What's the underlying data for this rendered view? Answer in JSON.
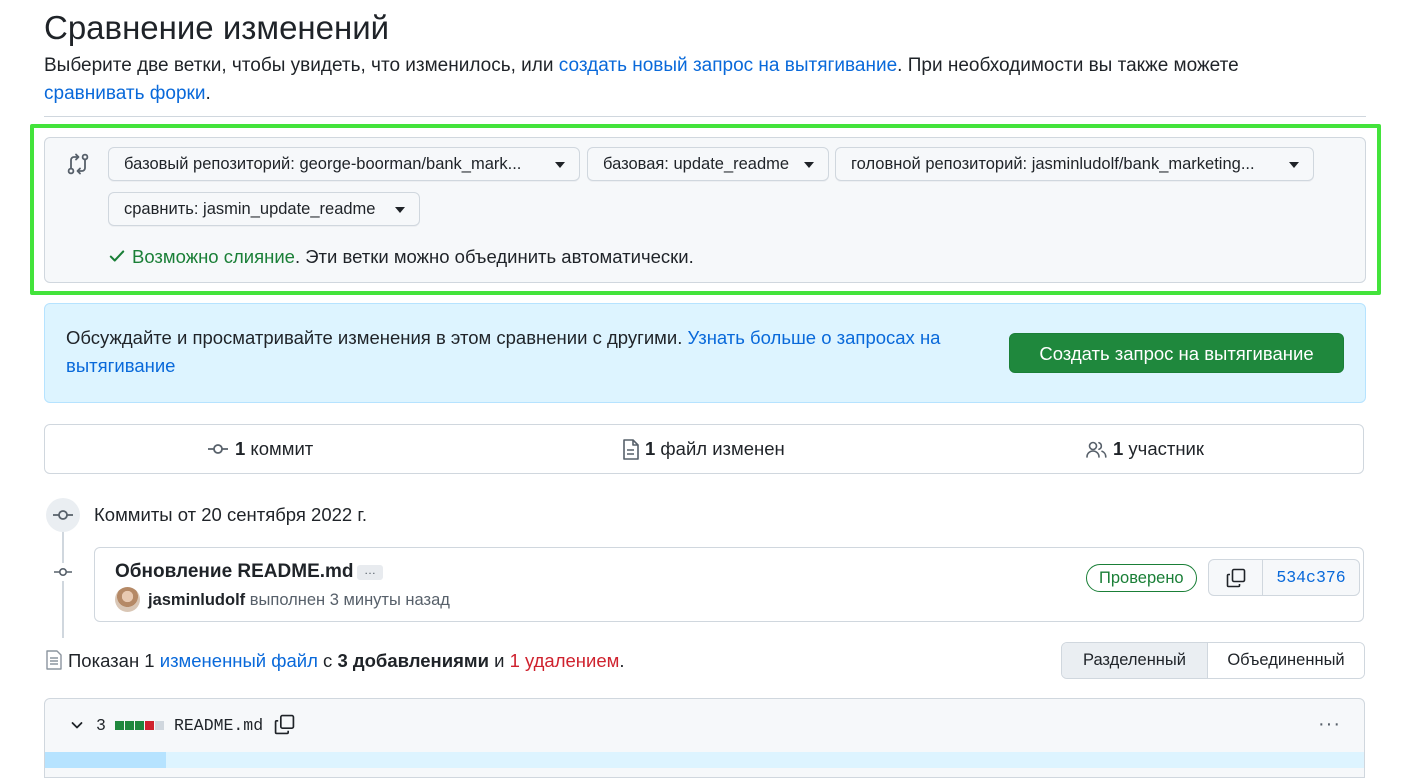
{
  "header": {
    "title": "Сравнение изменений",
    "desc_pre": "Выберите две ветки, чтобы увидеть, что изменилось, или ",
    "desc_link1": "создать новый запрос на вытягивание",
    "desc_mid": ". При необходимости вы также можете ",
    "desc_link2": "сравнивать форки",
    "desc_post": "."
  },
  "compare": {
    "base_repo_prefix": "базовый репозиторий: ",
    "base_repo": "george-boorman/bank_mark...",
    "base_prefix": "базовая: ",
    "base": "update_readme",
    "head_repo_prefix": "головной репозиторий: ",
    "head_repo": "jasminludolf/bank_marketing...",
    "compare_prefix": "сравнить: ",
    "compare": "jasmin_update_readme",
    "merge_ok": "Возможно слияние",
    "merge_rest": ". Эти ветки можно объединить автоматически."
  },
  "banner": {
    "text": "Обсуждайте и просматривайте изменения в этом сравнении с другими. ",
    "link": "Узнать больше о запросах на вытягивание",
    "button": "Создать запрос на вытягивание"
  },
  "stats": {
    "commits_n": "1",
    "commits_label": " коммит",
    "files_n": "1",
    "files_label": " файл изменен",
    "contrib_n": "1",
    "contrib_label": " участник"
  },
  "timeline": {
    "date_label": "Коммиты от 20 сентября 2022 г."
  },
  "commit": {
    "title": "Обновление README.md",
    "ellipsis": "…",
    "author": "jasminludolf",
    "meta": " выполнен 3 минуты назад",
    "verified": "Проверено",
    "sha": "534c376"
  },
  "files_summary": {
    "pre": "Показан 1 ",
    "link": "измененный файл",
    "mid": " с ",
    "adds": "3 добавлениями",
    "and": " и ",
    "dels": "1 удалением",
    "post": "."
  },
  "view_toggle": {
    "split": "Разделенный",
    "unified": "Объединенный"
  },
  "file": {
    "count": "3",
    "name": "README.md",
    "more": "···"
  },
  "colors": {
    "accent_green": "#1f883d",
    "link_blue": "#0969da",
    "danger_red": "#cf222e",
    "highlight_green": "#43e33b"
  },
  "icons": [
    "git-compare-icon",
    "chevron-down-icon",
    "check-icon",
    "git-commit-icon",
    "file-diff-icon",
    "people-icon",
    "copy-icon",
    "file-icon",
    "kebab-horizontal-icon"
  ]
}
